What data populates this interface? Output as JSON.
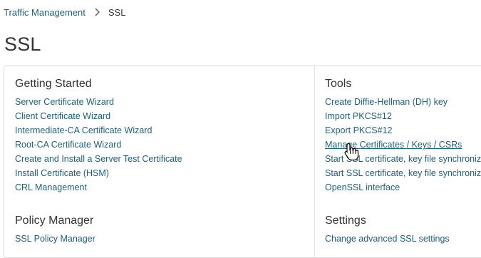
{
  "breadcrumb": {
    "parent": "Traffic Management",
    "current": "SSL"
  },
  "page": {
    "title": "SSL"
  },
  "getting_started": {
    "title": "Getting Started",
    "links": [
      "Server Certificate Wizard",
      "Client Certificate Wizard",
      "Intermediate-CA Certificate Wizard",
      "Root-CA Certificate Wizard",
      "Create and Install a Server Test Certificate",
      "Install Certificate (HSM)",
      "CRL Management"
    ]
  },
  "tools": {
    "title": "Tools",
    "links": [
      "Create Diffie-Hellman (DH) key",
      "Import PKCS#12",
      "Export PKCS#12",
      "Manage Certificates / Keys / CSRs",
      "Start SSL certificate, key file synchronization",
      "Start SSL certificate, key file synchronization",
      "OpenSSL interface"
    ]
  },
  "policy_manager": {
    "title": "Policy Manager",
    "links": [
      "SSL Policy Manager"
    ]
  },
  "settings": {
    "title": "Settings",
    "links": [
      "Change advanced SSL settings"
    ]
  },
  "icons": {
    "breadcrumb_separator": "chevron-right-icon",
    "cursor": "hand-pointer-icon"
  },
  "colors": {
    "link": "#1f5f78",
    "text": "#333333",
    "border": "#dcdcdc"
  }
}
